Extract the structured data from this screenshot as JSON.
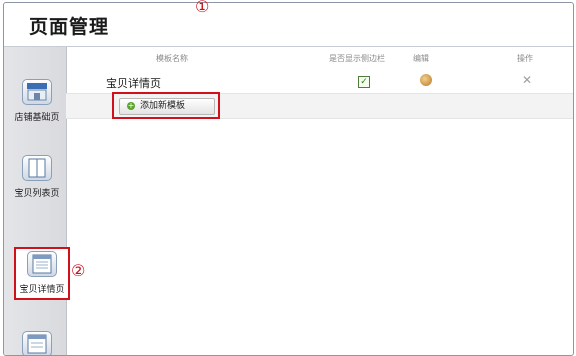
{
  "title": "页面管理",
  "markers": {
    "m1": "①",
    "m2": "②"
  },
  "table": {
    "headers": [
      "模板名称",
      "是否显示侧边栏",
      "编辑",
      "操作"
    ],
    "row": {
      "name": "宝贝详情页",
      "check": "✓",
      "delete": "✕"
    },
    "add_button": "添加新模板"
  },
  "sidebar": {
    "items": [
      {
        "label": "店铺基础页",
        "icon": "store-icon"
      },
      {
        "label": "宝贝列表页",
        "icon": "list-page-icon"
      },
      {
        "label": "宝贝详情页",
        "icon": "detail-page-icon"
      },
      {
        "label": "",
        "icon": "page-icon"
      }
    ]
  }
}
